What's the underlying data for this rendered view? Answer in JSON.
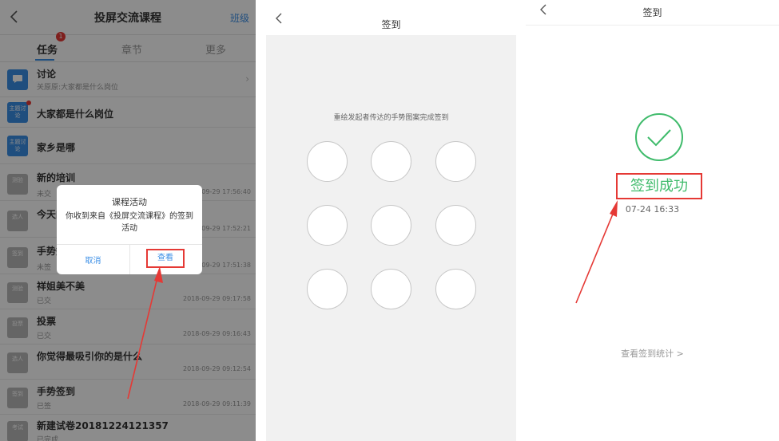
{
  "panel1": {
    "title": "投屏交流课程",
    "class_link": "班级",
    "tabs": [
      {
        "label": "任务"
      },
      {
        "label": "章节"
      },
      {
        "label": "更多"
      }
    ],
    "tab_badge": "1",
    "rows": [
      {
        "icon": "讨论",
        "title": "讨论",
        "sub": "关原原:大家都是什么岗位",
        "date": ""
      },
      {
        "icon": "主题讨论",
        "title": "大家都是什么岗位",
        "sub": "",
        "date": ""
      },
      {
        "icon": "主题讨论",
        "title": "家乡是哪",
        "sub": "",
        "date": ""
      },
      {
        "icon": "测验",
        "title": "新的培训",
        "sub": "未交",
        "date": "09-29 17:56:40"
      },
      {
        "icon": "选人",
        "title": "今天的",
        "sub": "",
        "date": "09-29 17:52:21"
      },
      {
        "icon": "签到",
        "title": "手势签",
        "sub": "未签",
        "date": "09-29 17:51:38"
      },
      {
        "icon": "测验",
        "title": "祥姐美不美",
        "sub": "已交",
        "date": "2018-09-29 09:17:58"
      },
      {
        "icon": "投票",
        "title": "投票",
        "sub": "已交",
        "date": "2018-09-29 09:16:43"
      },
      {
        "icon": "选人",
        "title": "你觉得最吸引你的是什么",
        "sub": "",
        "date": "2018-09-29 09:12:54"
      },
      {
        "icon": "签到",
        "title": "手势签到",
        "sub": "已签",
        "date": "2018-09-29 09:11:39"
      },
      {
        "icon": "考试",
        "title": "新建试卷20181224121357",
        "sub": "已完成",
        "date": ""
      }
    ],
    "dialog": {
      "title": "课程活动",
      "message": "你收到来自《投屏交流课程》的签到活动",
      "cancel": "取消",
      "view": "查看"
    }
  },
  "panel2": {
    "title": "签到",
    "hint": "重绘发起者传达的手势图案完成签到"
  },
  "panel3": {
    "title": "签到",
    "success": "签到成功",
    "time": "07-24 16:33",
    "stats": "查看签到统计 >"
  },
  "colors": {
    "accent_blue": "#3a8ee6",
    "success_green": "#3fbb6b",
    "highlight_red": "#e53935"
  }
}
